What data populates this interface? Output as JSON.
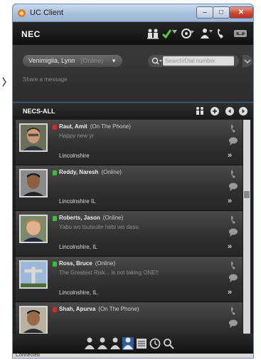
{
  "window": {
    "title": "UC Client"
  },
  "toolbar": {
    "brand": "NEC"
  },
  "user": {
    "name": "Venimiglia, Lynn",
    "status": "(Online)",
    "share_placeholder": "Share a message"
  },
  "search": {
    "placeholder": "Search/Dial number"
  },
  "group": {
    "title": "NECS-ALL"
  },
  "contacts": [
    {
      "name": "Raut, Amit",
      "status": "(On The Phone)",
      "message": "Happy new yr",
      "location": "Lincolnshire",
      "presence_color": "#d02a2a"
    },
    {
      "name": "Reddy, Naresh",
      "status": "(Online)",
      "message": "",
      "location": "Lincolnshire IL",
      "presence_color": "#3bbf3b"
    },
    {
      "name": "Roberts, Jason",
      "status": "(Online)",
      "message": "Yabu wo tsutsuite hebi wo dasu",
      "location": "Lincolnshire, IL",
      "presence_color": "#3bbf3b"
    },
    {
      "name": "Ross, Bruce",
      "status": "(Online)",
      "message": "The Greatest Risk... is not taking ONE!!",
      "location": "Lincolnshire, IL.",
      "presence_color": "#3bbf3b"
    },
    {
      "name": "Shah, Apurva",
      "status": "(On The Phone)",
      "message": "",
      "location": "",
      "presence_color": "#d02a2a"
    }
  ],
  "more_glyph": "»",
  "status_bar": {
    "text": "Connected"
  },
  "colors": {
    "online": "#3bbf3b",
    "busy": "#d02a2a",
    "accent": "#4c6f9a"
  }
}
